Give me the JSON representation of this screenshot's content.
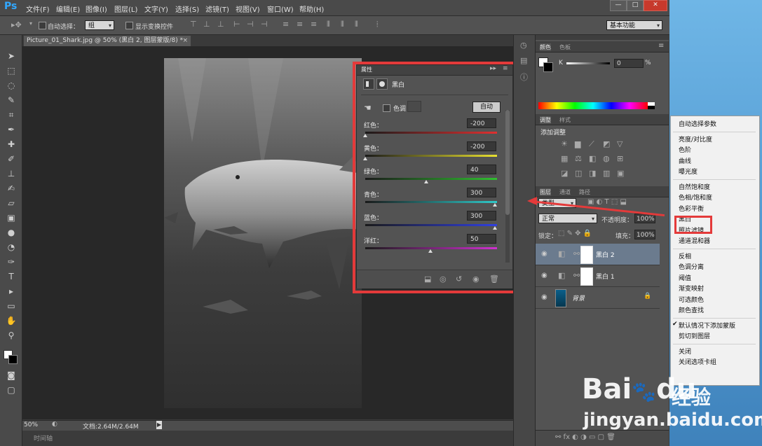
{
  "app": {
    "logo": "Ps"
  },
  "menu": [
    "文件(F)",
    "编辑(E)",
    "图像(I)",
    "图层(L)",
    "文字(Y)",
    "选择(S)",
    "滤镜(T)",
    "视图(V)",
    "窗口(W)",
    "帮助(H)"
  ],
  "options": {
    "auto_select_label": "自动选择：",
    "auto_select_value": "组",
    "show_transform_label": "显示变换控件",
    "workspace": "基本功能"
  },
  "document": {
    "tab_title": "Picture_01_Shark.jpg @ 50% (黑白 2, 图层蒙版/8) *",
    "zoom": "50%",
    "doc_info": "文档:2.64M/2.64M",
    "timeline_label": "时间轴"
  },
  "properties": {
    "tab_label": "属性",
    "title": "黑白",
    "tint_label": "色调",
    "auto_button": "自动",
    "sliders": [
      {
        "label": "红色：",
        "value": "-200",
        "pos": 0.0
      },
      {
        "label": "黄色：",
        "value": "-200",
        "pos": 0.0
      },
      {
        "label": "绿色：",
        "value": "40",
        "pos": 0.47
      },
      {
        "label": "青色：",
        "value": "300",
        "pos": 1.0
      },
      {
        "label": "蓝色：",
        "value": "300",
        "pos": 1.0
      },
      {
        "label": "洋红：",
        "value": "50",
        "pos": 0.5
      }
    ]
  },
  "color_panel": {
    "tabs": [
      "颜色",
      "色板"
    ],
    "channel": "K",
    "value": "0",
    "unit": "%"
  },
  "adjust_panel": {
    "tabs": [
      "调整",
      "样式"
    ],
    "add_label": "添加调整"
  },
  "layers_panel": {
    "tabs": [
      "图层",
      "通道",
      "路径"
    ],
    "kind": "类型",
    "blend_mode": "正常",
    "opacity_label": "不透明度：",
    "opacity_value": "100%",
    "lock_label": "锁定：",
    "fill_label": "填充：",
    "fill_value": "100%",
    "layers": [
      {
        "name": "黑白 2",
        "selected": true
      },
      {
        "name": "黑白 1",
        "selected": false
      },
      {
        "name": "背景",
        "selected": false
      }
    ]
  },
  "context_menu": {
    "groups": [
      [
        "自动选择参数"
      ],
      [
        "亮度/对比度",
        "色阶",
        "曲线",
        "曝光度"
      ],
      [
        "自然饱和度",
        "色相/饱和度",
        "色彩平衡",
        "黑白",
        "照片滤镜",
        "通道混和器"
      ],
      [
        "反相",
        "色调分离",
        "阈值",
        "渐变映射",
        "可选颜色",
        "颜色查找"
      ],
      [
        "默认情况下添加蒙版",
        "剪切到图层"
      ],
      [
        "关闭",
        "关闭选项卡组"
      ]
    ],
    "highlighted": "黑白",
    "checked": "默认情况下添加蒙版"
  },
  "watermark": {
    "brand": "Bai",
    "brand2": "du",
    "cn": "经验",
    "url": "jingyan.baidu.com"
  },
  "colors": {
    "highlight_red": "#e43a3a",
    "ps_blue": "#31a8ff"
  }
}
